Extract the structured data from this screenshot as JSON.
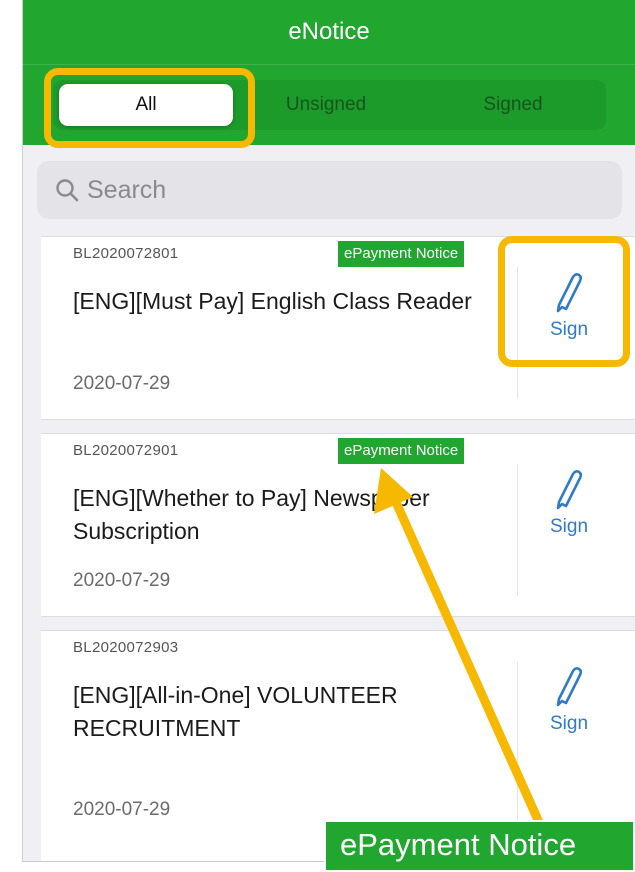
{
  "app": {
    "title": "eNotice"
  },
  "tabs": [
    {
      "label": "All",
      "active": true
    },
    {
      "label": "Unsigned",
      "active": false
    },
    {
      "label": "Signed",
      "active": false
    }
  ],
  "search": {
    "placeholder": "Search"
  },
  "notices": [
    {
      "ref": "BL2020072801",
      "badge": "ePayment Notice",
      "title": "[ENG][Must Pay] English Class Reader",
      "date": "2020-07-29",
      "action": "Sign",
      "action_icon": "pencil-icon"
    },
    {
      "ref": "BL2020072901",
      "badge": "ePayment Notice",
      "title": "[ENG][Whether to Pay] Newspaper Subscription",
      "date": "2020-07-29",
      "action": "Sign",
      "action_icon": "pencil-icon"
    },
    {
      "ref": "BL2020072903",
      "badge": "",
      "title": "[ENG][All-in-One] VOLUNTEER RECRUITMENT",
      "date": "2020-07-29",
      "action": "Sign",
      "action_icon": "pencil-icon"
    }
  ],
  "callout": {
    "label": "ePayment Notice"
  },
  "colors": {
    "header_green": "#21a630",
    "badge_green": "#21a630",
    "link_blue": "#2f7bc8",
    "highlight": "#f6b800"
  }
}
